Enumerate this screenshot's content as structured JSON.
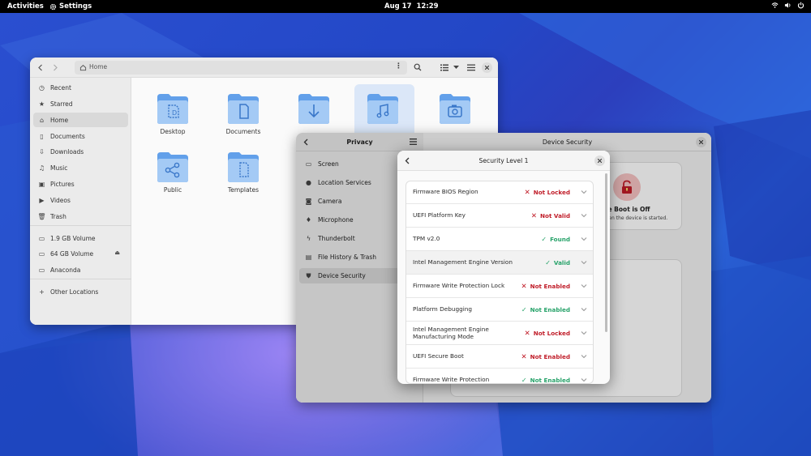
{
  "topbar": {
    "activities": "Activities",
    "app_name": "Settings",
    "date": "Aug 17",
    "time": "12:29"
  },
  "files": {
    "path": "Home",
    "sidebar": [
      {
        "label": "Recent",
        "icon": "clock-icon"
      },
      {
        "label": "Starred",
        "icon": "star-icon"
      },
      {
        "label": "Home",
        "icon": "home-icon"
      },
      {
        "label": "Documents",
        "icon": "document-icon"
      },
      {
        "label": "Downloads",
        "icon": "download-icon"
      },
      {
        "label": "Music",
        "icon": "music-icon"
      },
      {
        "label": "Pictures",
        "icon": "picture-icon"
      },
      {
        "label": "Videos",
        "icon": "video-icon"
      },
      {
        "label": "Trash",
        "icon": "trash-icon"
      },
      {
        "label": "1.9 GB Volume",
        "icon": "drive-icon"
      },
      {
        "label": "64 GB Volume",
        "icon": "drive-icon"
      },
      {
        "label": "Anaconda",
        "icon": "drive-icon"
      },
      {
        "label": "Other Locations",
        "icon": "plus-icon"
      }
    ],
    "folders": [
      {
        "label": "Desktop"
      },
      {
        "label": "Documents"
      },
      {
        "label": ""
      },
      {
        "label": ""
      },
      {
        "label": ""
      },
      {
        "label": "Public"
      },
      {
        "label": "Templates"
      }
    ]
  },
  "settings": {
    "left_title": "Privacy",
    "right_title": "Device Security",
    "privacy_items": [
      {
        "label": "Screen"
      },
      {
        "label": "Location Services"
      },
      {
        "label": "Camera"
      },
      {
        "label": "Microphone"
      },
      {
        "label": "Thunderbolt"
      },
      {
        "label": "File History & Trash"
      },
      {
        "label": "Device Security"
      }
    ],
    "secure_boot_title": "cure Boot is Off",
    "secure_boot_desc": "e when the device is started."
  },
  "dialog": {
    "title": "Security Level 1",
    "rows": [
      {
        "name": "Firmware BIOS Region",
        "status": "Not Locked",
        "ok": false
      },
      {
        "name": "UEFI Platform Key",
        "status": "Not Valid",
        "ok": false
      },
      {
        "name": "TPM v2.0",
        "status": "Found",
        "ok": true
      },
      {
        "name": "Intel Management Engine Version",
        "status": "Valid",
        "ok": true
      },
      {
        "name": "Firmware Write Protection Lock",
        "status": "Not Enabled",
        "ok": false
      },
      {
        "name": "Platform Debugging",
        "status": "Not Enabled",
        "ok": true
      },
      {
        "name": "Intel Management Engine Manufacturing Mode",
        "status": "Not Locked",
        "ok": false
      },
      {
        "name": "UEFI Secure Boot",
        "status": "Not Enabled",
        "ok": false
      },
      {
        "name": "Firmware Write Protection",
        "status": "Not Enabled",
        "ok": true
      }
    ]
  },
  "colors": {
    "folder_blue": "#62a0ea",
    "folder_light": "#a4caf5",
    "error_red": "#c01c28",
    "success_green": "#26a269"
  }
}
